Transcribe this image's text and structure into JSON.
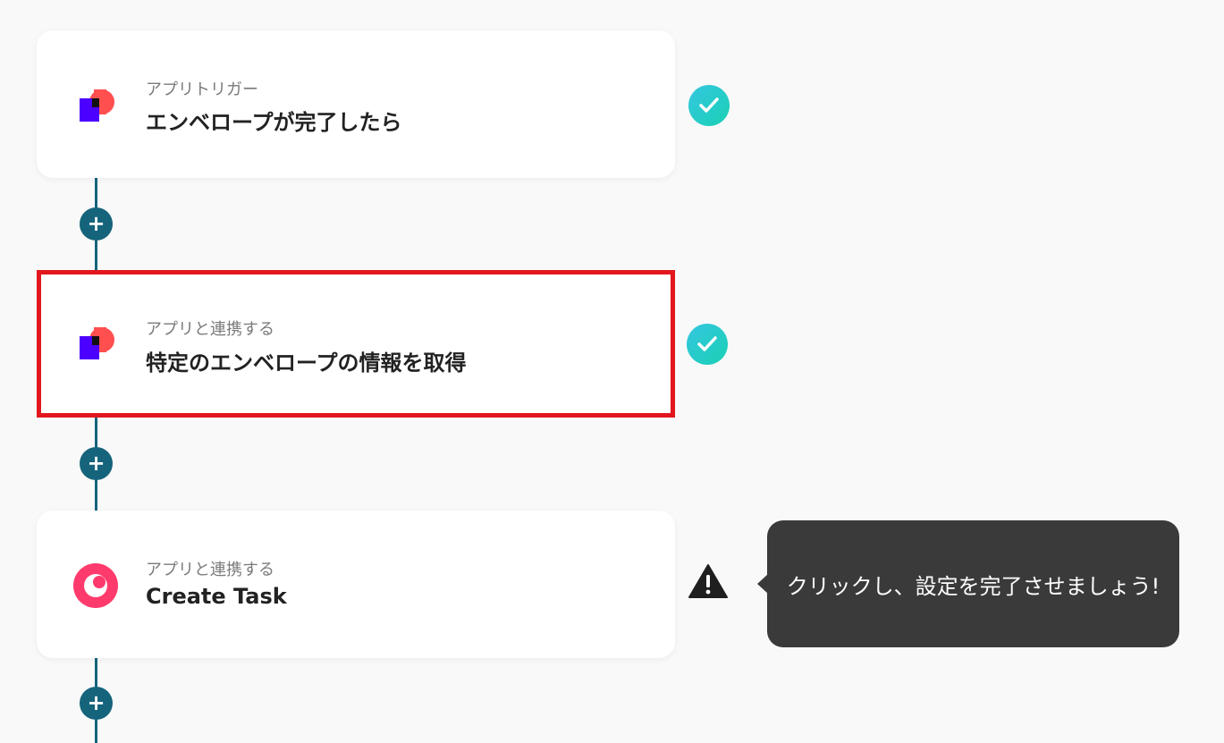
{
  "flow": {
    "steps": [
      {
        "kind": "アプリトリガー",
        "title": "エンベロープが完了したら",
        "app_icon": "docusign-icon",
        "status": "completed",
        "status_icon": "check-circle-icon"
      },
      {
        "kind": "アプリと連携する",
        "title": "特定のエンベロープの情報を取得",
        "app_icon": "docusign-icon",
        "status": "completed",
        "status_icon": "check-circle-icon",
        "highlighted": true
      },
      {
        "kind": "アプリと連携する",
        "title": "Create Task",
        "app_icon": "task-app-icon",
        "status": "warning",
        "status_icon": "warning-icon"
      }
    ],
    "add_step_symbol": "+",
    "tooltip": {
      "text": "クリックし、設定を完了させましょう!"
    }
  },
  "colors": {
    "background": "#f9f9f9",
    "connector": "#15647b",
    "check_gradient_start": "#35c6e0",
    "check_gradient_end": "#19d1b4",
    "highlight_border": "#e2171e",
    "tooltip_bg": "#3a3a3a",
    "docusign_red": "#ff4f4f",
    "docusign_purple": "#4c00ff",
    "task_app_pink": "#ff3a6c"
  }
}
